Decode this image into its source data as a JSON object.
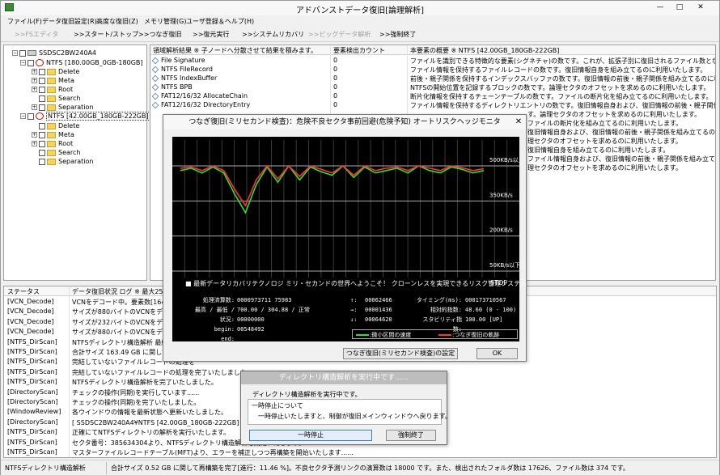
{
  "app": {
    "title": "アドバンストデータ復旧[論理解析]"
  },
  "menu": [
    "ファイル(F)",
    "データ復旧設定(R)",
    "高度な復旧(Z)",
    "メモリ管理(G)",
    "ユーザ登録＆ヘルプ(H)"
  ],
  "toolbar": [
    {
      "label": ">>FSエディタ",
      "enabled": false
    },
    {
      "label": ">>スタート/ストップ",
      "enabled": true
    },
    {
      "label": ">>つなぎ復旧",
      "enabled": true
    },
    {
      "label": ">>復元実行",
      "enabled": true
    },
    {
      "label": ">>システムリカバリ",
      "enabled": true
    },
    {
      "label": ">>ビッグデータ解析",
      "enabled": false
    },
    {
      "label": ">>強制終了",
      "enabled": true
    }
  ],
  "tree": {
    "root": "SSDSC2BW240A4",
    "volumes": [
      {
        "label": "NTFS [180.00GB_0GB-180GB]",
        "folders": [
          "Delete",
          "Meta",
          "Root",
          "Search",
          "Separation"
        ]
      },
      {
        "label": "NTFS [42.00GB_180GB-222GB]",
        "folders": [
          "Delete",
          "Meta",
          "Root",
          "Search",
          "Separation"
        ]
      }
    ]
  },
  "table": {
    "headers": [
      "領域解析結果 ※ 子ノードへ分散させて結果を積みます。",
      "要素検出カウント",
      "本要素の概要 ※ NTFS [42.00GB_180GB-222GB]"
    ],
    "rows": [
      {
        "name": "File Signature",
        "count": "0",
        "desc": "ファイルを識別できる特徴的な要素(シグネチャ)の数です。これが、拡張子別に復旧されるファイル数となります。"
      },
      {
        "name": "NTFS FileRecord",
        "count": "0",
        "desc": "ファイル情報を保持するファイルレコードの数です。復旧情報自身を組み立てるのに利用いたします。"
      },
      {
        "name": "NTFS IndexBuffer",
        "count": "0",
        "desc": "前後・親子関係を保持するインデックスバッファの数です。復旧情報の前後・親子関係を組み立てるのに利用いたします。"
      },
      {
        "name": "NTFS BPB",
        "count": "0",
        "desc": "NTFSの開始位置を記録するブロックの数です。論理セクタのオフセットを求めるのに利用いたします。"
      },
      {
        "name": "FAT12/16/32 AllocateChain",
        "count": "0",
        "desc": "断片化情報を保持するチェーンテーブルの数です。ファイルの断片化を組み立てるのに利用いたします。"
      },
      {
        "name": "FAT12/16/32 DirectoryEntry",
        "count": "0",
        "desc": "ファイル情報を保持するディレクトリエントリの数です。復旧情報自身および、復旧情報の前後・親子関係を組み立てるのに利用いたします。"
      }
    ],
    "overflow": [
      "す。論理セクタのオフセットを求めるのに利用いたします。",
      "ファイルの断片化を組み立てるのに利用いたします。",
      "復旧情報自身および、復旧情報の前後・親子関係を組み立てるのに利用いたします。",
      "理セクタのオフセットを求めるのに利用いたします。",
      "復旧情報自身を組み立てるのに利用いたします。",
      "ファイル情報自身および、復旧情報の前後・親子関係を組み立てるのに利用いたします。",
      "理セクタのオフセットを求めるのに利用いたします。"
    ]
  },
  "log": {
    "headers": [
      "ステータス",
      "データ復旧状況 ログ ※ 最大2500件"
    ],
    "rows": [
      {
        "k": "[VCN_Decode]",
        "v": "VCNをデコード中。要素数[1647275"
      },
      {
        "k": "[VCN_Decode]",
        "v": "サイズが880バイトのVCNをデコード中"
      },
      {
        "k": "[VCN_Decode]",
        "v": "サイズが232バイトのVCNをデコード中"
      },
      {
        "k": "[VCN_Decode]",
        "v": "サイズが880バイトのVCNをデコード中"
      },
      {
        "k": "[NTFS_DirScan]",
        "v": "NTFSディレクトリ構造解析 最終処理"
      },
      {
        "k": "[NTFS_DirScan]",
        "v": "合計サイズ 163.49 GB に関して再構"
      },
      {
        "k": "[NTFS_DirScan]",
        "v": "完結していないファイルレコードの処理を"
      },
      {
        "k": "[NTFS_DirScan]",
        "v": "完結していないファイルレコードの処理を完了いたしました。"
      },
      {
        "k": "[NTFS_DirScan]",
        "v": "NTFSディレクトリ構造解析を完了いたしました。"
      },
      {
        "k": "[DirectoryScan]",
        "v": "チェックの操作(同期)を実行しています......"
      },
      {
        "k": "[DirectoryScan]",
        "v": "チェックの操作(同期)を完了いたしました。"
      },
      {
        "k": "[WindowReview]",
        "v": "各ウインドウの情報を最新状態へ更新いたしました。"
      },
      {
        "k": "[DirectoryScan]",
        "v": "[ SSDSC2BW240A4¥NTFS [42.00GB_180GB-222GB] ] デ"
      },
      {
        "k": "[NTFS_DirScan]",
        "v": "正確にてNTFSディレクトリの解析を実行いたします。"
      },
      {
        "k": "[NTFS_DirScan]",
        "v": "セクタ番号：385634304より、NTFSディレクトリ構造解析を開始いたします。"
      },
      {
        "k": "[NTFS_DirScan]",
        "v": "マスターファイルレコードテーブル(MFT)より、エラーを補正しつつ再構築を開始いたします......"
      }
    ]
  },
  "status": {
    "left": "NTFSディレクトリ構造解析",
    "right": "合計サイズ 0.52 GB に関して再構築を完了[進行：11.46 %]。不良セクタ予測リンクの演算数は 18000 です。また、検出されたフォルダ数は 17626、ファイル数は 374 です。"
  },
  "monitor": {
    "title": "つなぎ復旧(ミリセカンド検査)：危険不良セクタ事前回避(危険予知) オートリスクヘッジモニタ",
    "banner": "■ 最新データリカバリテクノロジ ミリ・セカンドの世界へようこそ！ クローンレスを実現できるリスク管理システム",
    "stop": "STOP",
    "yLabels": [
      "500KB/s以上",
      "350KB/s",
      "200KB/s",
      "50KB/s以下"
    ],
    "stats": {
      "processed_label": "処理済算数:",
      "processed": "0000973711 75983",
      "minmax_label": "最高 / 最低 / 状況:",
      "minmax": "700.00 / 304.88 / 正常",
      "begin_label": "begin:",
      "begin": "00000000",
      "end_label": "end:",
      "end": "00548492",
      "up": "00062466",
      "right": "00001436",
      "down": "00064620",
      "timing_label": "タイミング(ms):",
      "timing": "000173710567",
      "rel_label": "相対的指数:",
      "rel": "48.60 (0 - 100)",
      "stab_label": "スタビリティ指数:",
      "stab": "100.00 [UP]"
    },
    "legend": [
      {
        "label": ":微小区間の速度",
        "color": "#33dd33"
      },
      {
        "label": ":つなぎ復旧の軌跡",
        "color": "#ff3333"
      }
    ],
    "buttons": [
      "つなぎ復旧(ミリセカンド検査)の設定",
      "OK"
    ]
  },
  "chart_data": {
    "type": "line",
    "ylim": [
      50,
      500
    ],
    "series": [
      {
        "name": ":微小区間の速度",
        "values": [
          480,
          490,
          470,
          495,
          470,
          380,
          300,
          420,
          495,
          430,
          500,
          440,
          495,
          475,
          460,
          500,
          450,
          495,
          470,
          480,
          490,
          470,
          500,
          480,
          470,
          495,
          485,
          470,
          480
        ]
      },
      {
        "name": ":つなぎ復旧の軌跡",
        "values": [
          490,
          495,
          480,
          500,
          480,
          400,
          330,
          440,
          500,
          445,
          500,
          455,
          500,
          485,
          470,
          500,
          460,
          500,
          480,
          490,
          495,
          480,
          500,
          490,
          480,
          500,
          492,
          480,
          488
        ]
      }
    ]
  },
  "dialog": {
    "title": "ディレクトリ構造解析を実行中です......",
    "message": "ディレクトリ構造解析を実行中です。",
    "section": "一時停止について",
    "hint": "一時停止いたしますと、制御が復旧メインウィンドウへ戻ります。",
    "buttons": [
      "一時停止",
      "強制終了"
    ]
  }
}
